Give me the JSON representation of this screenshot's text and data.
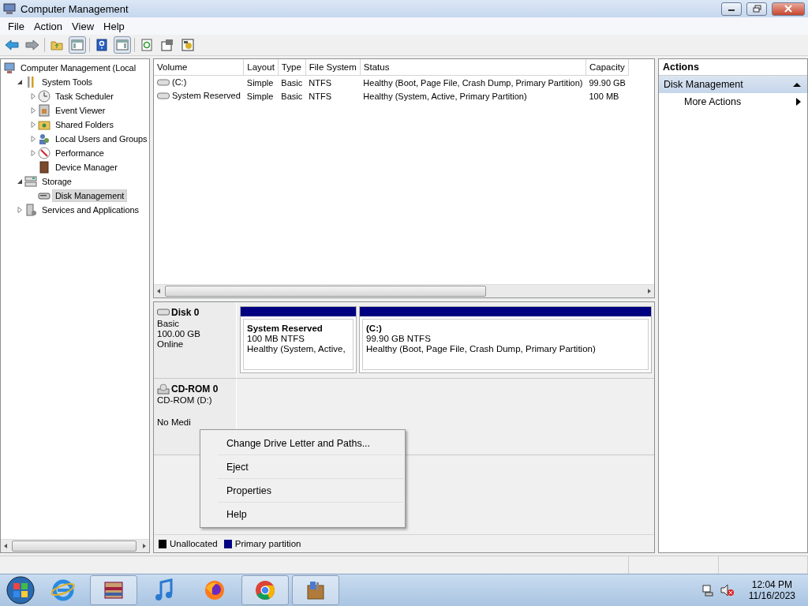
{
  "window": {
    "title": "Computer Management"
  },
  "menu": [
    {
      "label": "File"
    },
    {
      "label": "Action"
    },
    {
      "label": "View"
    },
    {
      "label": "Help"
    }
  ],
  "toolbar": [
    {
      "kind": "back",
      "pressed": false
    },
    {
      "kind": "forward",
      "pressed": false
    },
    {
      "kind": "up",
      "pressed": false
    },
    {
      "kind": "tree",
      "pressed": true
    },
    {
      "kind": "help",
      "pressed": false
    },
    {
      "kind": "actionpane",
      "pressed": true
    },
    {
      "kind": "refresh",
      "pressed": false
    },
    {
      "kind": "properties",
      "pressed": false
    },
    {
      "kind": "settings",
      "pressed": false
    }
  ],
  "tree": {
    "items": [
      {
        "label": "Computer Management (Local",
        "kind": "computer",
        "selected": false,
        "children": [
          {
            "label": "System Tools",
            "kind": "tools",
            "expanded": true,
            "selected": false,
            "children": [
              {
                "label": "Task Scheduler",
                "kind": "clock",
                "expanded": false,
                "selected": false
              },
              {
                "label": "Event Viewer",
                "kind": "log",
                "expanded": false,
                "selected": false
              },
              {
                "label": "Shared Folders",
                "kind": "share",
                "expanded": false,
                "selected": false
              },
              {
                "label": "Local Users and Groups",
                "kind": "users",
                "expanded": false,
                "selected": false
              },
              {
                "label": "Performance",
                "kind": "performance",
                "expanded": false,
                "selected": false
              },
              {
                "label": "Device Manager",
                "kind": "device",
                "selected": false
              }
            ]
          },
          {
            "label": "Storage",
            "kind": "storage",
            "expanded": true,
            "selected": false,
            "children": [
              {
                "label": "Disk Management",
                "kind": "disk",
                "selected": true
              }
            ]
          },
          {
            "label": "Services and Applications",
            "kind": "services",
            "expanded": false,
            "selected": false
          }
        ]
      }
    ]
  },
  "table": {
    "columns": [
      "Volume",
      "Layout",
      "Type",
      "File System",
      "Status",
      "Capacity"
    ],
    "rows": [
      [
        "(C:)",
        "Simple",
        "Basic",
        "NTFS",
        "Healthy (Boot, Page File, Crash Dump, Primary Partition)",
        "99.90 GB"
      ],
      [
        "System Reserved",
        "Simple",
        "Basic",
        "NTFS",
        "Healthy (System, Active, Primary Partition)",
        "100 MB"
      ]
    ]
  },
  "disks": [
    {
      "name": "Disk 0",
      "kind": "disk",
      "type": "Basic",
      "size": "100.00 GB",
      "status": "Online",
      "partitions": [
        {
          "name": "System Reserved",
          "detail": "100 MB NTFS",
          "status": "Healthy (System, Active,"
        },
        {
          "name": "(C:)",
          "detail": "99.90 GB NTFS",
          "status": "Healthy (Boot, Page File, Crash Dump, Primary Partition)"
        }
      ]
    },
    {
      "name": "CD-ROM 0",
      "kind": "cdrom",
      "type": "CD-ROM (D:)",
      "status": "No Medi"
    }
  ],
  "legend": [
    {
      "label": "Unallocated",
      "color": "#000000"
    },
    {
      "label": "Primary partition",
      "color": "#000080"
    }
  ],
  "context_menu": [
    {
      "label": "Change Drive Letter and Paths..."
    },
    {
      "label": "Eject"
    },
    {
      "label": "Properties"
    },
    {
      "label": "Help"
    }
  ],
  "actions": {
    "title": "Actions",
    "sections": [
      {
        "label": "Disk Management",
        "expanded": true,
        "items": [
          {
            "label": "More Actions"
          }
        ]
      }
    ]
  },
  "taskbar": {
    "apps": [
      {
        "kind": "ie",
        "open": false
      },
      {
        "kind": "archive",
        "open": true
      },
      {
        "kind": "music",
        "open": false
      },
      {
        "kind": "firefox",
        "open": false
      },
      {
        "kind": "chrome",
        "open": true
      },
      {
        "kind": "tools",
        "open": true
      }
    ],
    "time": "12:04 PM",
    "date": "11/16/2023"
  }
}
